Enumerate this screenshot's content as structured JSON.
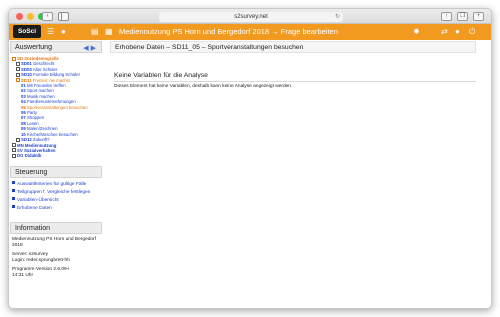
{
  "browser": {
    "url": "s2survey.net"
  },
  "app": {
    "logo_text": "SoSci",
    "title": "Mediennutzung PS Horn und Bergedorf 2018 → Frage bearbeiten"
  },
  "sidebar": {
    "section_title": "Auswertung",
    "tree": [
      {
        "code": "SD",
        "label": "Soziodemografie",
        "level": 1,
        "style": "orange-bold"
      },
      {
        "code": "SD01",
        "label": "Geschlecht",
        "level": 2,
        "style": "blue"
      },
      {
        "code": "SD03",
        "label": "Alter Schüler",
        "level": 2,
        "style": "blue"
      },
      {
        "code": "SD10",
        "label": "Formale Bildung Schüler",
        "level": 2,
        "style": "blue"
      },
      {
        "code": "SD11",
        "label": "Freizeit: nie machst",
        "level": 2,
        "style": "orange"
      },
      {
        "code": "01",
        "label": "Mit Freunden treffen",
        "level": 3,
        "style": "blue"
      },
      {
        "code": "02",
        "label": "Sport machen",
        "level": 3,
        "style": "blue"
      },
      {
        "code": "03",
        "label": "Musik machen",
        "level": 3,
        "style": "blue"
      },
      {
        "code": "04",
        "label": "Familienunternehmungen",
        "level": 3,
        "style": "blue"
      },
      {
        "code": "05",
        "label": "Sportveranstaltungen besuchen",
        "level": 3,
        "style": "orange"
      },
      {
        "code": "06",
        "label": "Party",
        "level": 3,
        "style": "blue"
      },
      {
        "code": "07",
        "label": "Shoppen",
        "level": 3,
        "style": "blue"
      },
      {
        "code": "08",
        "label": "Lesen",
        "level": 3,
        "style": "blue"
      },
      {
        "code": "09",
        "label": "Malen/Zeichnen",
        "level": 3,
        "style": "blue"
      },
      {
        "code": "10",
        "label": "Kirche/Moschee besuchen",
        "level": 3,
        "style": "blue"
      },
      {
        "code": "SD12",
        "label": "Zukunft?",
        "level": 2,
        "style": "blue"
      },
      {
        "code": "MN",
        "label": "Mediennutzung",
        "level": 1,
        "style": "blue-bold"
      },
      {
        "code": "SV",
        "label": "Sozialverhalten",
        "level": 1,
        "style": "blue-bold"
      },
      {
        "code": "DG",
        "label": "Didaktik",
        "level": 1,
        "style": "blue-bold"
      }
    ],
    "control": {
      "title": "Steuerung",
      "items": [
        "Auswahlkriterien für gültige Fälle",
        "Teilgruppen f. Vergleiche festlegen",
        "Variablen-Übersicht",
        "Erhobene Daten"
      ]
    },
    "info": {
      "title": "Information",
      "project": "Mediennutzung PS Horn und Bergedorf 2018",
      "server": "Server: s2survey",
      "login": "Login: reder.sprungbrett-hh",
      "version": "Programm-Version 2.6.09-i",
      "time": "14:31 Uhr"
    }
  },
  "main": {
    "page_title": "Erhobene Daten – SD11_05 – Sportveranstaltungen besuchen",
    "heading": "Keine Variablen für die Analyse",
    "message": "Dieses Element hat keine Variablen, deshalb kann keine Analyse angezeigt werden."
  },
  "colors": {
    "header_orange": "#f29a1f",
    "link_blue": "#1b3fcf",
    "active_orange": "#e07712"
  }
}
